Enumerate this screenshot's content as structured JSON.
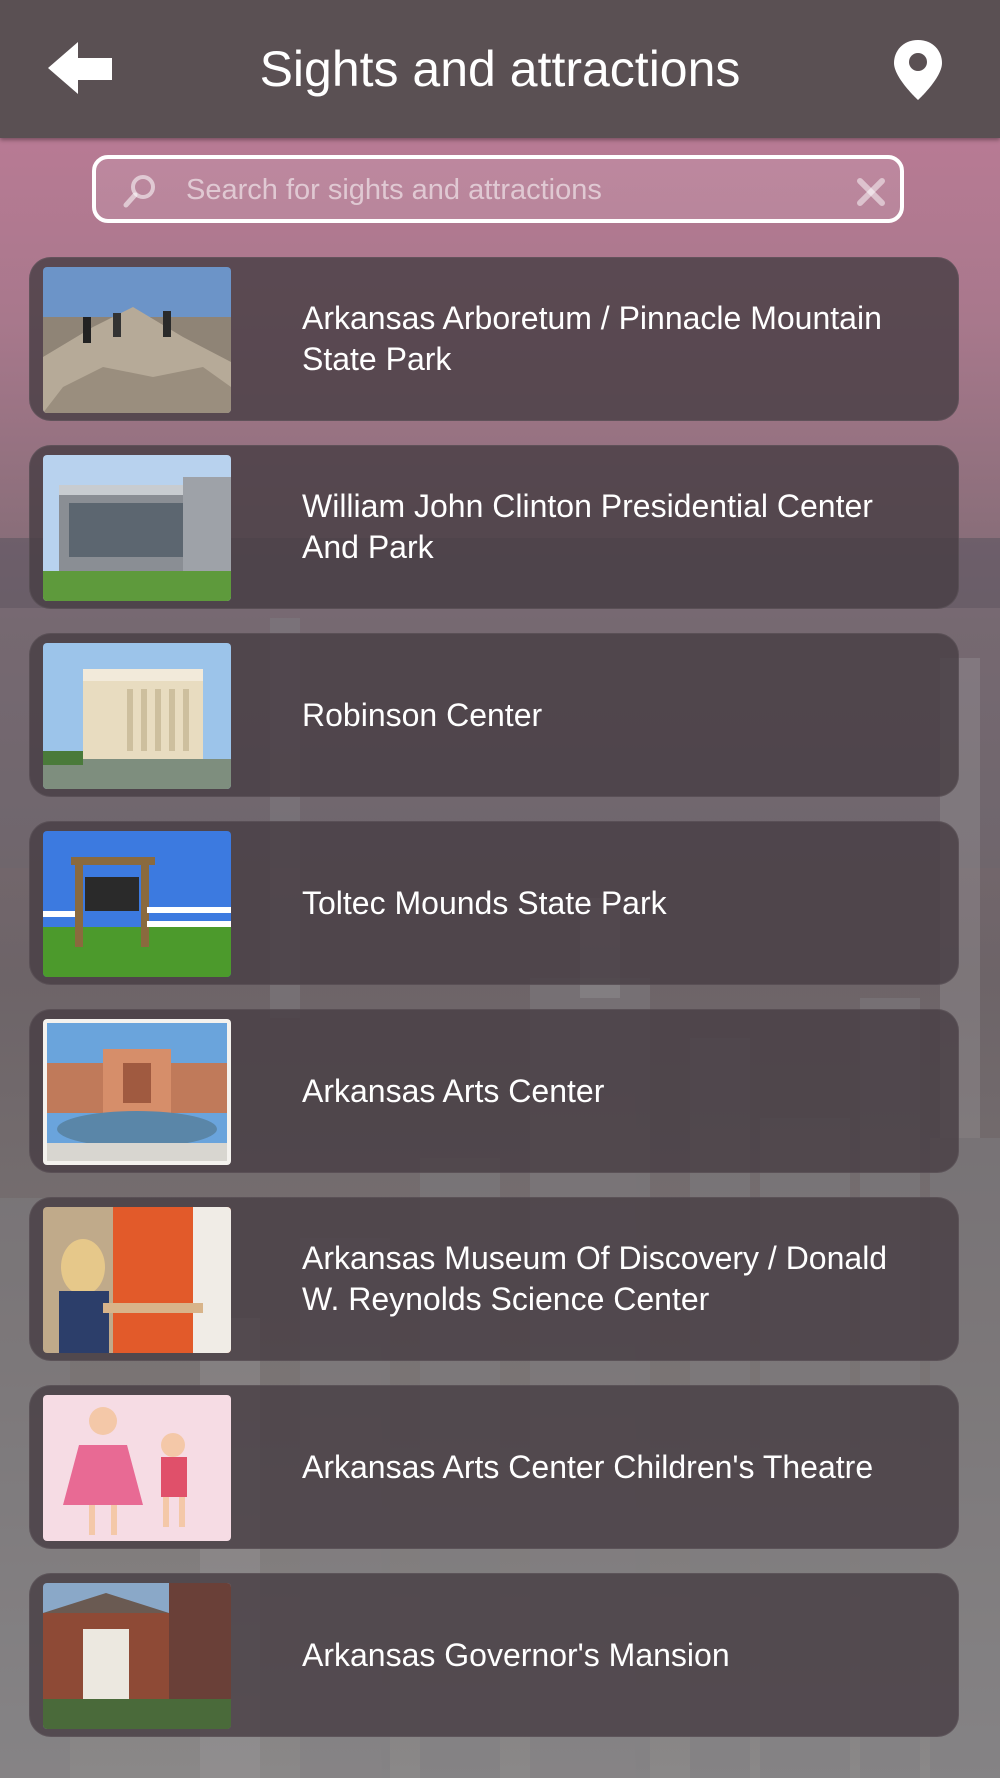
{
  "header": {
    "title": "Sights and attractions",
    "back_icon": "arrow-left-icon",
    "map_icon": "map-pin-icon"
  },
  "search": {
    "placeholder": "Search for sights and attractions",
    "value": ""
  },
  "items": [
    {
      "label": "Arkansas Arboretum / Pinnacle Mountain State Park"
    },
    {
      "label": "William John Clinton Presidential Center And Park"
    },
    {
      "label": "Robinson Center"
    },
    {
      "label": "Toltec Mounds State Park"
    },
    {
      "label": "Arkansas Arts Center"
    },
    {
      "label": "Arkansas Museum Of Discovery / Donald W. Reynolds Science Center"
    },
    {
      "label": "Arkansas Arts Center Children's Theatre"
    },
    {
      "label": "Arkansas Governor's Mansion"
    }
  ],
  "colors": {
    "header_bg": "#5a5053",
    "row_bg": "#483e44",
    "text": "#ffffff"
  }
}
